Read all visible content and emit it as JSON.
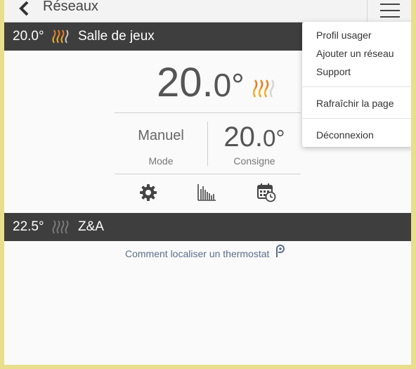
{
  "topbar": {
    "back_icon": "chevron-left-icon",
    "title": "Réseaux",
    "menu_icon": "hamburger-menu-icon"
  },
  "zones": [
    {
      "temp": "20.0°",
      "name": "Salle de jeux",
      "heating": true
    },
    {
      "temp": "22.5°",
      "name": "Z&A",
      "heating": false
    }
  ],
  "detail": {
    "current_whole": "20.",
    "current_frac": "0",
    "current_deg": "°",
    "mode_value": "Manuel",
    "mode_label": "Mode",
    "setpoint_whole": "20.",
    "setpoint_frac": "0",
    "setpoint_deg": "°",
    "setpoint_label": "Consigne",
    "tools": [
      "gear-icon",
      "bar-chart-icon",
      "calendar-clock-icon"
    ]
  },
  "help_link": {
    "text": "Comment localiser un thermostat",
    "icon": "location-pin-icon"
  },
  "menu": {
    "items": [
      "Profil usager",
      "Ajouter un réseau",
      "Support",
      "Rafraîchir la page",
      "Déconnexion"
    ]
  },
  "colors": {
    "bar_bg": "#3e3e3e",
    "heat_active_start": "#f5b82e",
    "heat_active_end": "#e8741e",
    "heat_inactive": "#7a7a7a",
    "link": "#5b6f8c",
    "window_border": "#e8de8c"
  }
}
